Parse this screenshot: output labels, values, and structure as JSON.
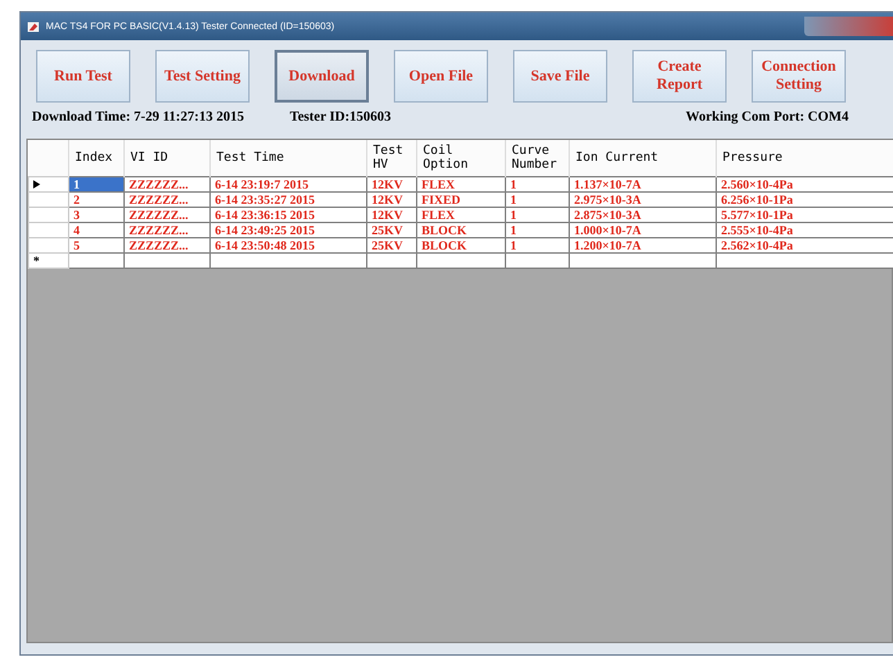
{
  "window": {
    "title": "MAC TS4 FOR PC BASIC(V1.4.13) Tester Connected (ID=150603)"
  },
  "toolbar": [
    {
      "label": "Run Test",
      "selected": false
    },
    {
      "label": "Test Setting",
      "selected": false
    },
    {
      "label": "Download",
      "selected": true
    },
    {
      "label": "Open File",
      "selected": false
    },
    {
      "label": "Save File",
      "selected": false
    },
    {
      "label": "Create Report",
      "selected": false
    },
    {
      "label": "Connection Setting",
      "selected": false
    }
  ],
  "info": {
    "download_time": "Download Time: 7-29  11:27:13 2015",
    "tester_id": "Tester ID:150603",
    "com_port": "Working Com Port: COM4"
  },
  "table": {
    "columns": [
      "Index",
      "VI ID",
      "Test Time",
      "Test HV",
      "Coil Option",
      "Curve Number",
      "Ion Current",
      "Pressure"
    ],
    "rows": [
      {
        "selected": true,
        "cells": [
          "1",
          "ZZZZZZ...",
          "6-14 23:19:7 2015",
          "12KV",
          "FLEX",
          "1",
          "1.137×10-7A",
          "2.560×10-4Pa"
        ]
      },
      {
        "selected": false,
        "cells": [
          "2",
          "ZZZZZZ...",
          "6-14 23:35:27 2015",
          "12KV",
          "FIXED",
          "1",
          "2.975×10-3A",
          "6.256×10-1Pa"
        ]
      },
      {
        "selected": false,
        "cells": [
          "3",
          "ZZZZZZ...",
          "6-14 23:36:15 2015",
          "12KV",
          "FLEX",
          "1",
          "2.875×10-3A",
          "5.577×10-1Pa"
        ]
      },
      {
        "selected": false,
        "cells": [
          "4",
          "ZZZZZZ...",
          "6-14 23:49:25 2015",
          "25KV",
          "BLOCK",
          "1",
          "1.000×10-7A",
          "2.555×10-4Pa"
        ]
      },
      {
        "selected": false,
        "cells": [
          "5",
          "ZZZZZZ...",
          "6-14 23:50:48 2015",
          "25KV",
          "BLOCK",
          "1",
          "1.200×10-7A",
          "2.562×10-4Pa"
        ]
      }
    ],
    "new_row_marker": "*"
  }
}
